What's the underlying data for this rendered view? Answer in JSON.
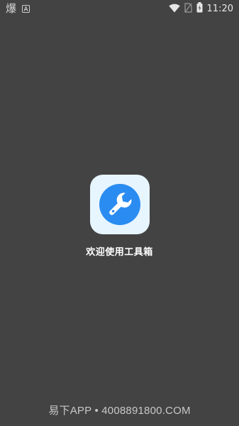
{
  "status_bar": {
    "left_glyph": "爆",
    "time": "11:20",
    "icons": [
      "notification-a-icon",
      "wifi-icon",
      "no-sim-icon",
      "battery-icon"
    ]
  },
  "splash": {
    "app_name": "欢迎使用工具箱",
    "icon": "wrench-icon",
    "icon_bg_color": "#e7f5ff",
    "icon_color": "#2a8cf0"
  },
  "watermark": {
    "text": "易下APP • 4008891800.COM"
  },
  "colors": {
    "background": "#434343"
  }
}
